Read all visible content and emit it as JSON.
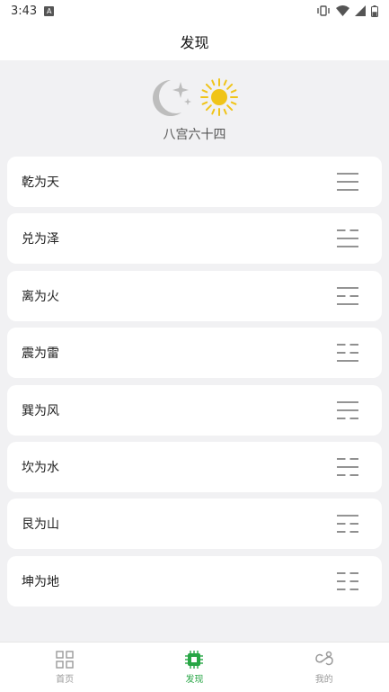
{
  "status_bar": {
    "time": "3:43",
    "notification_badge": "A",
    "battery_level_percent": 50
  },
  "header": {
    "title": "发现"
  },
  "hero": {
    "subtitle": "八宫六十四"
  },
  "trigrams": [
    {
      "label": "乾为天",
      "lines": [
        1,
        1,
        1
      ]
    },
    {
      "label": "兑为泽",
      "lines": [
        0,
        1,
        1
      ]
    },
    {
      "label": "离为火",
      "lines": [
        1,
        0,
        1
      ]
    },
    {
      "label": "震为雷",
      "lines": [
        0,
        0,
        1
      ]
    },
    {
      "label": "巽为风",
      "lines": [
        1,
        1,
        0
      ]
    },
    {
      "label": "坎为水",
      "lines": [
        0,
        1,
        0
      ]
    },
    {
      "label": "艮为山",
      "lines": [
        1,
        0,
        0
      ]
    },
    {
      "label": "坤为地",
      "lines": [
        0,
        0,
        0
      ]
    }
  ],
  "nav": [
    {
      "label": "首页",
      "icon": "grid-icon",
      "active": false
    },
    {
      "label": "发现",
      "icon": "chip-icon",
      "active": true
    },
    {
      "label": "我的",
      "icon": "link-icon",
      "active": false
    }
  ],
  "colors": {
    "accent": "#27a645",
    "inactive": "#9a9a9a",
    "sun": "#f0c419",
    "moon": "#bdbdbd"
  }
}
